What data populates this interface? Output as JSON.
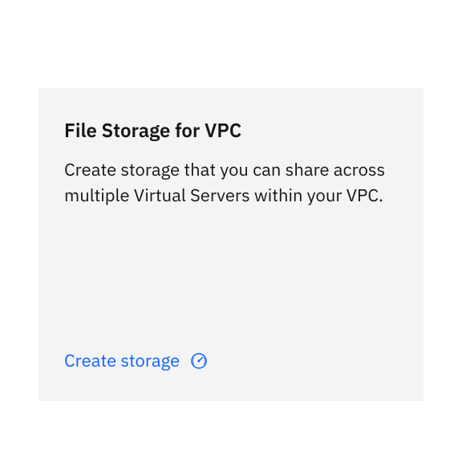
{
  "card": {
    "title": "File Storage for VPC",
    "description": "Create storage that you can share across multiple Virtual Servers within your VPC.",
    "action_label": "Create storage"
  },
  "colors": {
    "link": "#0f62fe",
    "card_bg": "#f4f4f4",
    "text": "#161616"
  }
}
